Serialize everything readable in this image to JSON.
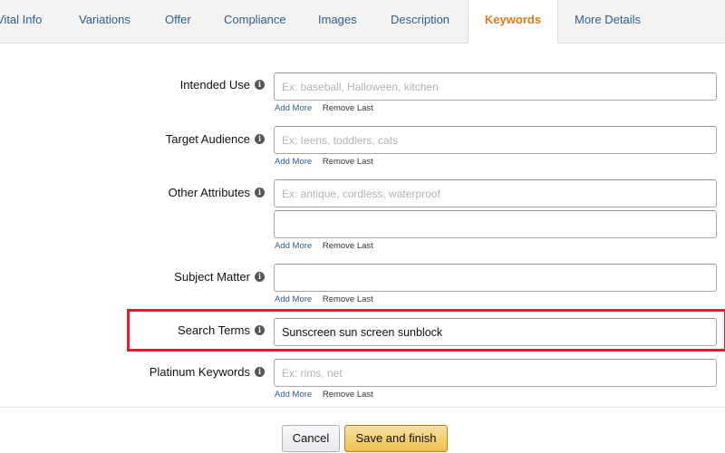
{
  "tabs": [
    {
      "label": "Vital Info"
    },
    {
      "label": "Variations"
    },
    {
      "label": "Offer"
    },
    {
      "label": "Compliance"
    },
    {
      "label": "Images"
    },
    {
      "label": "Description"
    },
    {
      "label": "Keywords",
      "active": true
    },
    {
      "label": "More Details"
    }
  ],
  "info_icon": "i",
  "links": {
    "add_more": "Add More",
    "remove_last": "Remove Last"
  },
  "fields": {
    "intended_use": {
      "label": "Intended Use",
      "placeholder": "Ex: baseball, Halloween, kitchen",
      "value": ""
    },
    "target_audience": {
      "label": "Target Audience",
      "placeholder": "Ex: teens, toddlers, cats",
      "value": ""
    },
    "other_attributes": {
      "label": "Other Attributes",
      "placeholder": "Ex: antique, cordless, waterproof",
      "value": "",
      "second_value": ""
    },
    "subject_matter": {
      "label": "Subject Matter",
      "placeholder": "",
      "value": ""
    },
    "search_terms": {
      "label": "Search Terms",
      "placeholder": "",
      "value": "Sunscreen sun screen sunblock"
    },
    "platinum_keywords": {
      "label": "Platinum Keywords",
      "placeholder": "Ex: rims, net",
      "value": ""
    }
  },
  "buttons": {
    "cancel": "Cancel",
    "save": "Save and finish"
  },
  "colors": {
    "tab_link": "#2f5d87",
    "tab_active": "#e47911",
    "highlight_box": "#e0192b",
    "save_button": "#f0c14b"
  }
}
